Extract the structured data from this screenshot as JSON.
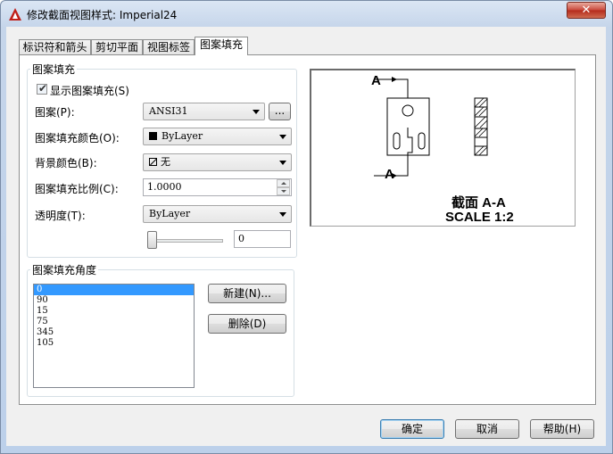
{
  "window": {
    "title": "修改截面视图样式: Imperial24",
    "close_label": "✕"
  },
  "tabs": [
    {
      "label": "标识符和箭头"
    },
    {
      "label": "剪切平面"
    },
    {
      "label": "视图标签"
    },
    {
      "label": "图案填充"
    }
  ],
  "hatch_group": {
    "title": "图案填充",
    "show_hatch": {
      "label": "显示图案填充(S)",
      "checked": true
    },
    "pattern": {
      "label": "图案(P):",
      "value": "ANSI31",
      "browse_label": "..."
    },
    "hatch_color": {
      "label": "图案填充颜色(O):",
      "value": "ByLayer"
    },
    "background_color": {
      "label": "背景颜色(B):",
      "value": "无"
    },
    "hatch_scale": {
      "label": "图案填充比例(C):",
      "value": "1.0000"
    },
    "transparency": {
      "label": "透明度(T):",
      "value": "ByLayer",
      "slider_value": "0"
    }
  },
  "angle_group": {
    "title": "图案填充角度",
    "angles": [
      "0",
      "90",
      "15",
      "75",
      "345",
      "105"
    ],
    "selected_index": 0,
    "new_label": "新建(N)...",
    "delete_label": "删除(D)"
  },
  "preview": {
    "top_label": "A",
    "bottom_label": "A",
    "caption_line1": "截面 A-A",
    "caption_line2": "SCALE 1:2"
  },
  "footer": {
    "ok_label": "确定",
    "cancel_label": "取消",
    "help_label": "帮助(H)"
  },
  "colors": {
    "title_icon": "#c0201a",
    "selection": "#3399ff"
  }
}
